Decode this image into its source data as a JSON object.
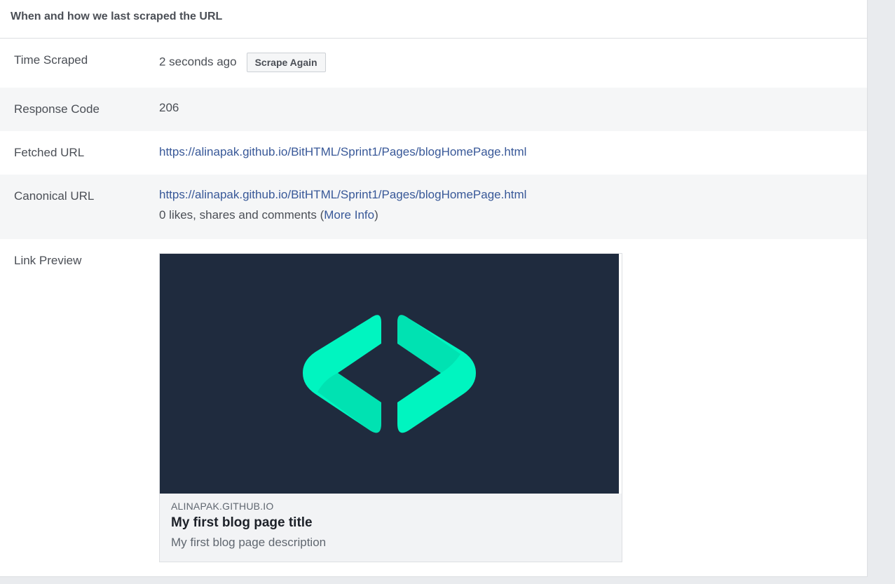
{
  "header": {
    "title": "When and how we last scraped the URL"
  },
  "time_scraped": {
    "label": "Time Scraped",
    "value": "2 seconds ago",
    "button_label": "Scrape Again"
  },
  "response_code": {
    "label": "Response Code",
    "value": "206"
  },
  "fetched_url": {
    "label": "Fetched URL",
    "value": "https://alinapak.github.io/BitHTML/Sprint1/Pages/blogHomePage.html"
  },
  "canonical_url": {
    "label": "Canonical URL",
    "value": "https://alinapak.github.io/BitHTML/Sprint1/Pages/blogHomePage.html",
    "engagement_prefix": "0 likes, shares and comments (",
    "more_info_label": "More Info",
    "engagement_suffix": ")"
  },
  "link_preview": {
    "label": "Link Preview",
    "image_icon": "code-brackets-logo-icon",
    "domain": "ALINAPAK.GITHUB.IO",
    "title": "My first blog page title",
    "description": "My first blog page description"
  },
  "colors": {
    "link": "#385898",
    "preview_bg": "#1f2b3e",
    "logo_accent": "#00ffc3"
  }
}
